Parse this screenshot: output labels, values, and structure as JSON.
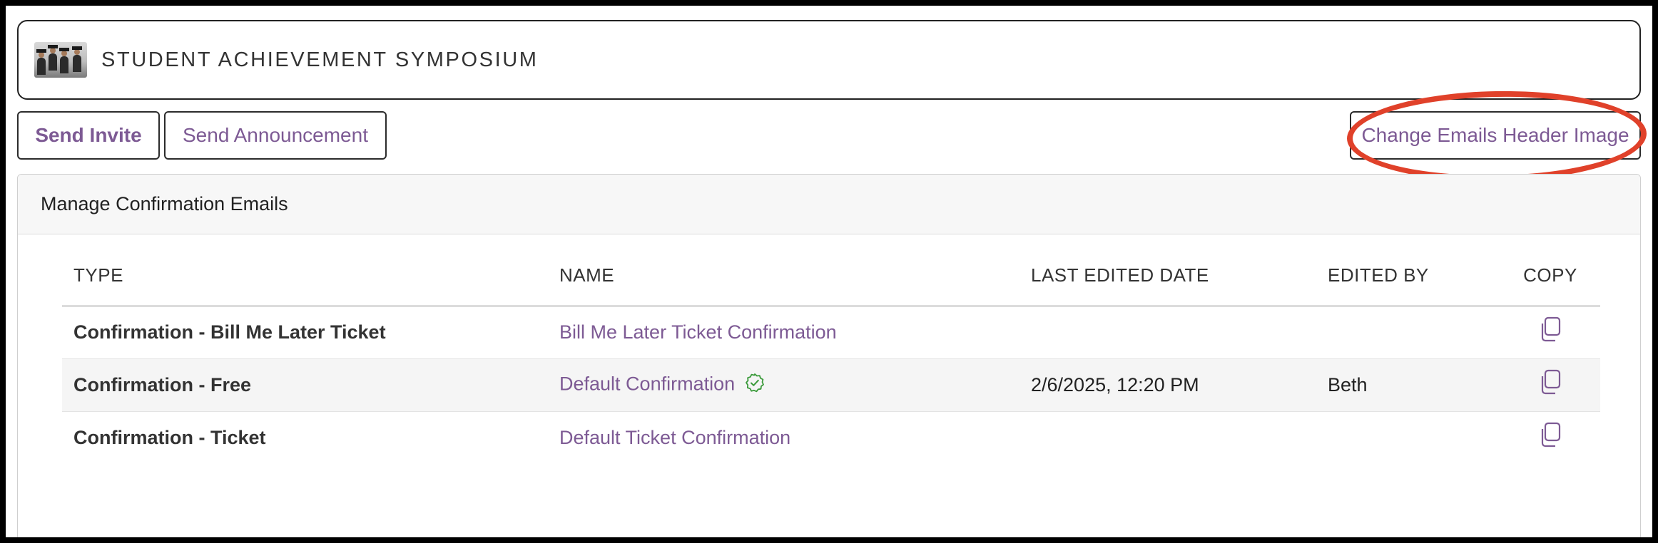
{
  "event": {
    "title": "STUDENT ACHIEVEMENT SYMPOSIUM",
    "thumbnail_icon": "graduates-photo"
  },
  "actions": {
    "send_invite": "Send Invite",
    "send_announcement": "Send Announcement",
    "change_header_image": "Change Emails Header Image"
  },
  "panel": {
    "title": "Manage Confirmation Emails"
  },
  "table": {
    "headers": {
      "type": "TYPE",
      "name": "NAME",
      "last_edited": "LAST EDITED DATE",
      "edited_by": "EDITED BY",
      "copy": "COPY"
    },
    "rows": [
      {
        "type": "Confirmation - Bill Me Later Ticket",
        "name": "Bill Me Later Ticket Confirmation",
        "last_edited": "",
        "edited_by": "",
        "default": false
      },
      {
        "type": "Confirmation - Free",
        "name": "Default Confirmation",
        "last_edited": "2/6/2025, 12:20 PM",
        "edited_by": "Beth",
        "default": true
      },
      {
        "type": "Confirmation - Ticket",
        "name": "Default Ticket Confirmation",
        "last_edited": "",
        "edited_by": "",
        "default": false
      }
    ]
  },
  "colors": {
    "link": "#7d5a94",
    "annotation": "#e0412a",
    "check": "#3a9a3a"
  }
}
